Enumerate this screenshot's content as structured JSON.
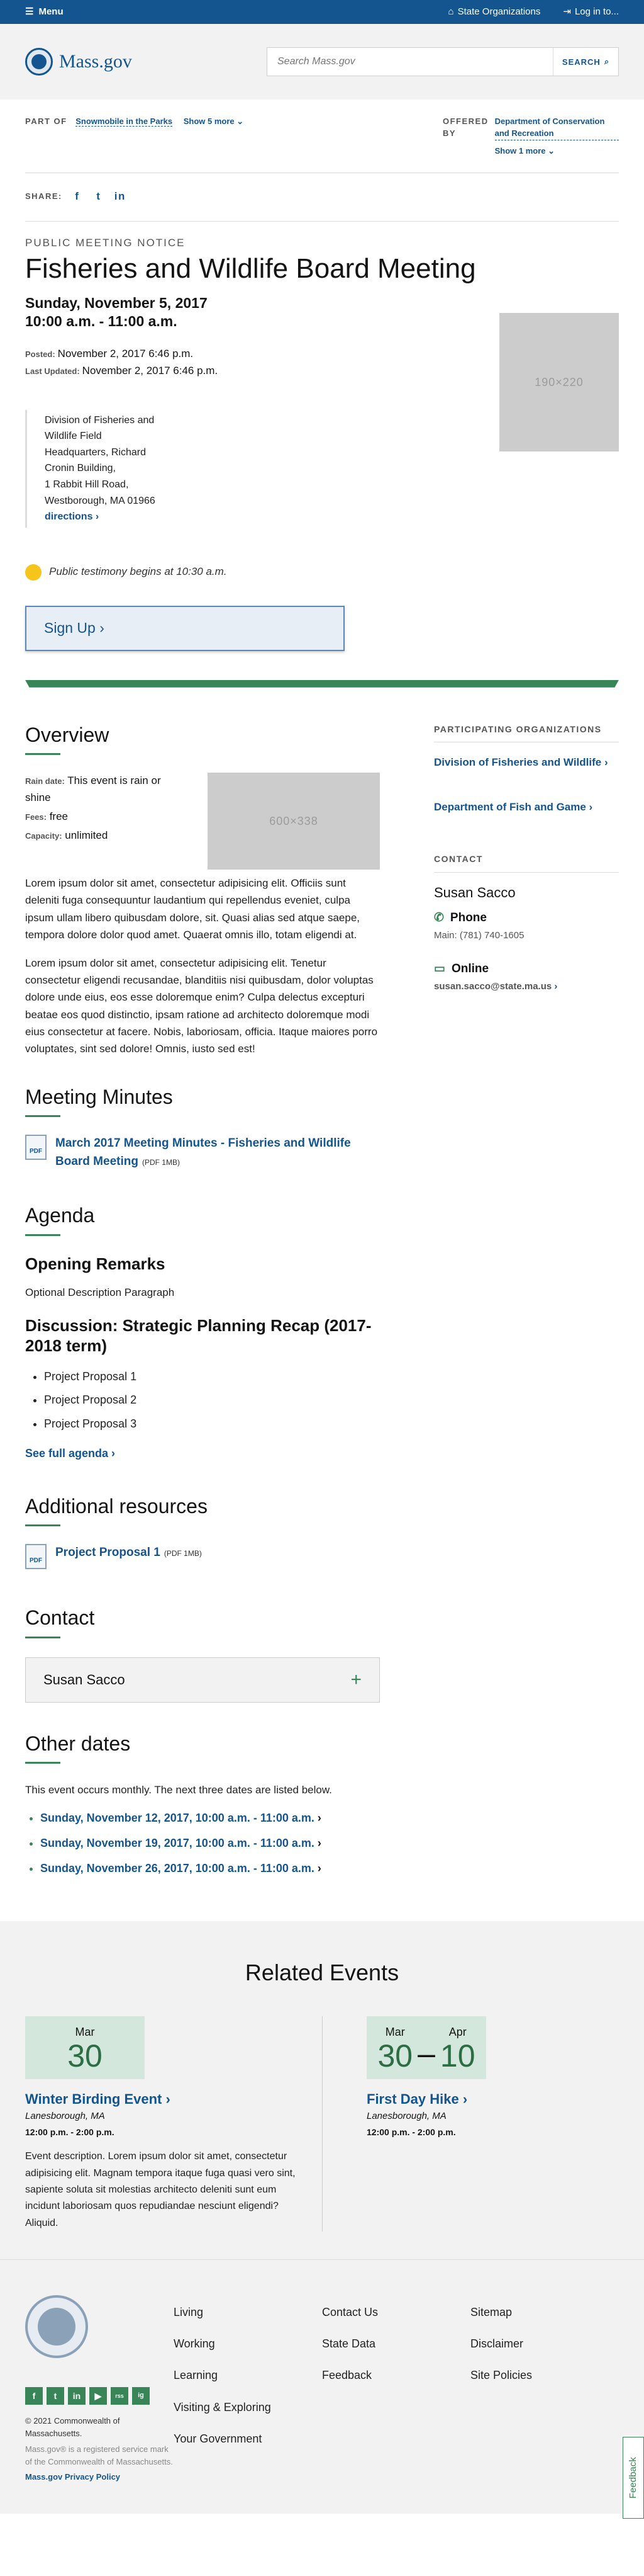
{
  "topbar": {
    "menu": "Menu",
    "state_orgs": "State Organizations",
    "login": "Log in to..."
  },
  "header": {
    "logo": "Mass.gov",
    "search_placeholder": "Search Mass.gov",
    "search_button": "SEARCH"
  },
  "orgs": {
    "part_of_label": "PART OF",
    "part_of": "Snowmobile in the Parks",
    "show_more": "Show 5 more",
    "offered_by_label": "OFFERED BY",
    "offered_by": "Department of Conservation and Recreation",
    "show_more_right": "Show 1 more"
  },
  "share": {
    "label": "SHARE:",
    "facebook": "f",
    "twitter": "t",
    "linkedin": "in"
  },
  "event": {
    "eyebrow": "PUBLIC MEETING NOTICE",
    "title": "Fisheries and Wildlife Board Meeting",
    "date": "Sunday, November 5, 2017",
    "time": "10:00 a.m. - 11:00 a.m.",
    "posted_label": "Posted:",
    "posted": "November 2, 2017 6:46 p.m.",
    "updated_label": "Last Updated:",
    "updated": "November 2, 2017 6:46 p.m.",
    "hero_image": "190×220",
    "address": [
      "Division of Fisheries and",
      "Wildlife Field",
      "Headquarters, Richard",
      "Cronin Building,",
      "1 Rabbit Hill Road,",
      "Westborough, MA 01966"
    ],
    "directions": "directions",
    "testimony": "Public testimony begins at 10:30 a.m.",
    "signup": "Sign Up"
  },
  "overview": {
    "title": "Overview",
    "rain_label": "Rain date:",
    "rain": "This event is rain or shine",
    "fees_label": "Fees:",
    "fees": "free",
    "capacity_label": "Capacity:",
    "capacity": "unlimited",
    "image": "600×338",
    "para1": "Lorem ipsum dolor sit amet, consectetur adipisicing elit. Officiis sunt deleniti fuga consequuntur laudantium qui repellendus eveniet, culpa ipsum ullam libero quibusdam dolore, sit. Quasi alias sed atque saepe, tempora dolore dolor quod amet. Quaerat omnis illo, totam eligendi at.",
    "para2": "Lorem ipsum dolor sit amet, consectetur adipisicing elit. Tenetur consectetur eligendi recusandae, blanditiis nisi quibusdam, dolor voluptas dolore unde eius, eos esse doloremque enim? Culpa delectus excepturi beatae eos quod distinctio, ipsam ratione ad architecto doloremque modi eius consectetur at facere. Nobis, laboriosam, officia. Itaque maiores porro voluptates, sint sed dolore! Omnis, iusto sed est!"
  },
  "minutes": {
    "title": "Meeting Minutes",
    "doc": "March 2017 Meeting Minutes - Fisheries and Wildlife Board Meeting",
    "doc_meta": "(PDF 1MB)",
    "icon": "PDF"
  },
  "agenda": {
    "title": "Agenda",
    "sub1": "Opening Remarks",
    "sub1_desc": "Optional Description Paragraph",
    "sub2": "Discussion: Strategic Planning Recap (2017-2018 term)",
    "items": [
      "Project Proposal 1",
      "Project Proposal 2",
      "Project Proposal 3"
    ],
    "full": "See full agenda"
  },
  "resources": {
    "title": "Additional resources",
    "doc": "Project Proposal 1",
    "doc_meta": "(PDF 1MB)",
    "icon": "PDF"
  },
  "contact_section": {
    "title": "Contact",
    "name": "Susan Sacco",
    "expand": "+"
  },
  "other_dates": {
    "title": "Other dates",
    "intro": "This event occurs monthly. The next three dates are listed below.",
    "dates": [
      "Sunday, November 12, 2017, 10:00 a.m. - 11:00 a.m.",
      "Sunday, November 19, 2017, 10:00 a.m. - 11:00 a.m.",
      "Sunday, November 26, 2017, 10:00 a.m. - 11:00 a.m."
    ]
  },
  "sidebar": {
    "orgs_title": "PARTICIPATING ORGANIZATIONS",
    "orgs": [
      "Division of Fisheries and Wildlife",
      "Department of Fish and Game"
    ],
    "contact_title": "CONTACT",
    "contact_name": "Susan Sacco",
    "phone_label": "Phone",
    "phone_main_label": "Main:",
    "phone": "(781) 740-1605",
    "online_label": "Online",
    "email": "susan.sacco@state.ma.us"
  },
  "related": {
    "title": "Related Events",
    "events": [
      {
        "month": "Mar",
        "day": "30",
        "title": "Winter Birding Event",
        "loc": "Lanesborough, MA",
        "time": "12:00 p.m. - 2:00 p.m.",
        "desc": "Event description. Lorem ipsum dolor sit amet, consectetur adipisicing elit. Magnam tempora itaque fuga quasi vero sint, sapiente soluta sit molestias architecto deleniti sunt eum incidunt laboriosam quos repudiandae nesciunt eligendi? Aliquid."
      },
      {
        "month": "Mar",
        "day": "30",
        "month2": "Apr",
        "day2": "10",
        "dash": "–",
        "title": "First Day Hike",
        "loc": "Lanesborough, MA",
        "time": "12:00 p.m. - 2:00 p.m."
      }
    ]
  },
  "footer": {
    "col1": [
      "Living",
      "Working",
      "Learning",
      "Visiting & Exploring",
      "Your Government"
    ],
    "col2": [
      "Contact Us",
      "State Data",
      "Feedback"
    ],
    "col3": [
      "Sitemap",
      "Disclaimer",
      "Site Policies"
    ],
    "social": [
      "f",
      "t",
      "in",
      "▶",
      "rss",
      "ig"
    ],
    "copyright": "© 2021 Commonwealth of Massachusetts.",
    "trademark": "Mass.gov® is a registered service mark of the Commonwealth of Massachusetts.",
    "privacy": "Mass.gov Privacy Policy",
    "feedback": "Feedback"
  },
  "colors": {
    "brand": "#14558f",
    "accent": "#388557",
    "bell": "#f6c51b"
  }
}
